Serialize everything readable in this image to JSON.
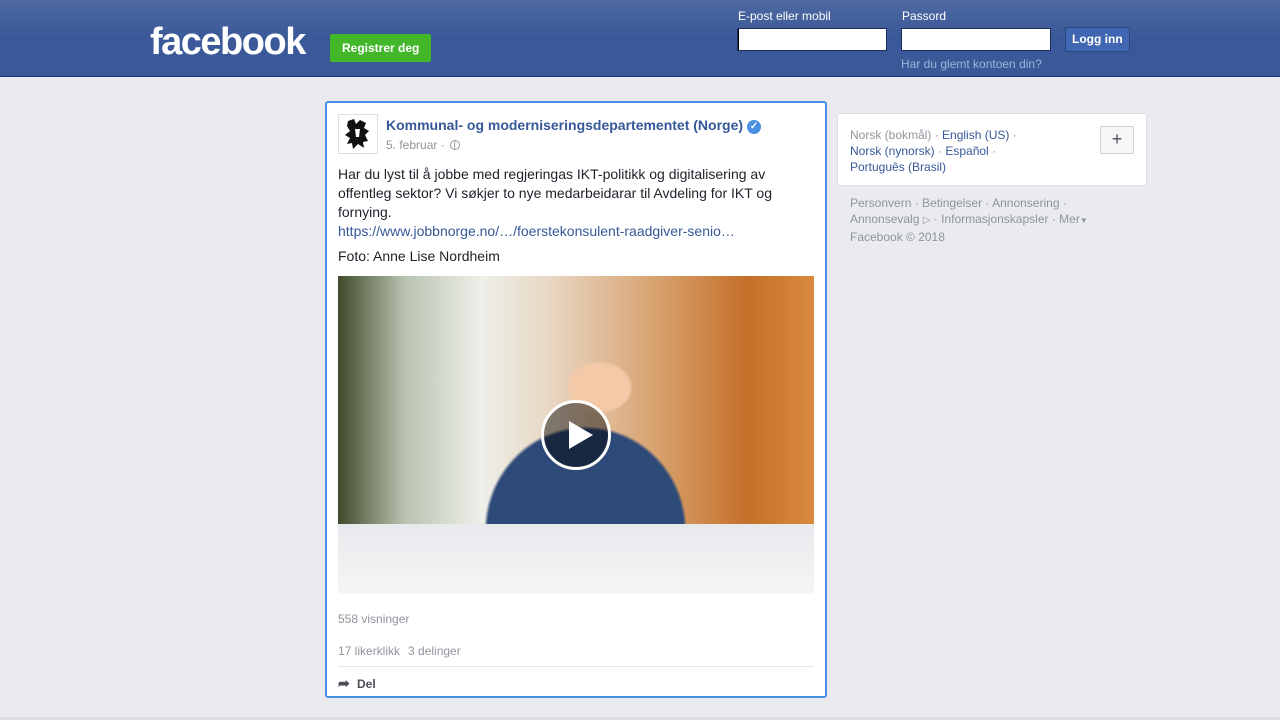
{
  "header": {
    "logo": "facebook",
    "register_label": "Registrer deg",
    "email_label": "E-post eller mobil",
    "email_value": "",
    "password_label": "Passord",
    "password_value": "",
    "login_label": "Logg inn",
    "forgot_label": "Har du glemt kontoen din?"
  },
  "post": {
    "page_name": "Kommunal- og moderniseringsdepartementet (Norge)",
    "verified_icon": "✓",
    "date": "5. februar",
    "date_separator": "·",
    "text": "Har du lyst til å jobbe med regjeringas IKT-politikk og digitalisering av offentleg sektor? Vi søkjer to nye medarbeidarar til Avdeling for IKT og fornying.",
    "link": "https://www.jobbnorge.no/…/foerstekonsulent-raadgiver-senio…",
    "photo_credit": "Foto: Anne Lise Nordheim",
    "views": "558 visninger",
    "likes": "17 likerklikk",
    "shares": "3 delinger",
    "share_label": "Del"
  },
  "sidebar": {
    "lang_current": "Norsk (bokmål)",
    "langs": [
      "English (US)",
      "Norsk (nynorsk)",
      "Español",
      "Português (Brasil)"
    ],
    "add_label": "+",
    "footer_links": [
      "Personvern",
      "Betingelser",
      "Annonsering",
      "Annonsevalg",
      "Informasjonskapsler",
      "Mer"
    ],
    "copyright": "Facebook © 2018"
  },
  "colors": {
    "brand": "#3b5998",
    "link": "#365899",
    "register_green": "#42b72a",
    "focus_border": "#4a90e2"
  },
  "icons": [
    "globe-icon",
    "verified-icon",
    "play-icon",
    "share-icon",
    "plus-icon",
    "adchoices-icon",
    "caret-down-icon"
  ]
}
